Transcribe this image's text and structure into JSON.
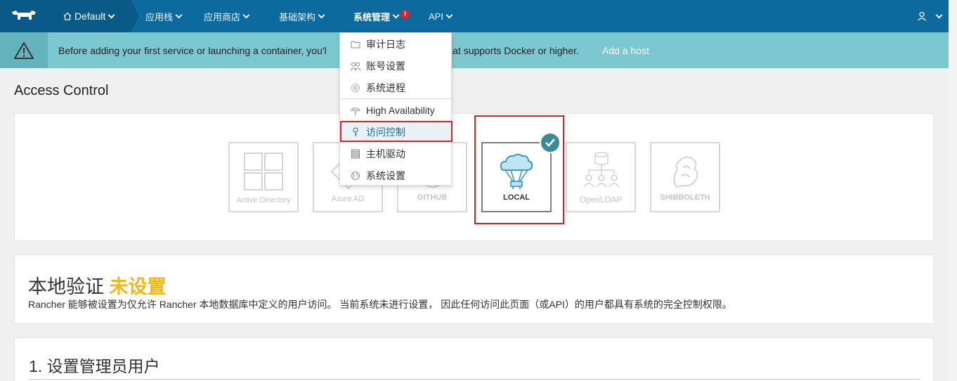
{
  "nav": {
    "environment": "Default",
    "items": [
      {
        "label": "应用栈"
      },
      {
        "label": "应用商店"
      },
      {
        "label": "基础架构"
      },
      {
        "label": "系统管理",
        "alert": "!"
      },
      {
        "label": "API"
      }
    ]
  },
  "banner": {
    "message": "Before adding your first service or launching a container, you'll need to add a Linux host that supports Docker or higher.",
    "message_visible_start": "Before adding your first service or launching a container, you'l",
    "message_visible_end": "t that supports Docker or higher.",
    "link": "Add a host"
  },
  "page": {
    "title": "Access Control"
  },
  "providers": [
    {
      "label": "Active Directory",
      "icon": "windows-icon"
    },
    {
      "label": "Azure AD",
      "icon": "azure-icon"
    },
    {
      "label": "GITHUB",
      "icon": "github-icon"
    },
    {
      "label": "LOCAL",
      "icon": "cloud-icon",
      "selected": true
    },
    {
      "label": "OpenLDAP",
      "icon": "ldap-icon"
    },
    {
      "label": "SHIBBOLETH",
      "icon": "shibboleth-icon"
    }
  ],
  "local_auth": {
    "heading": "本地验证",
    "status": "未设置",
    "description": "Rancher 能够被设置为仅允许 Rancher 本地数据库中定义的用户访问。 当前系统未进行设置， 因此任何访问此页面（或API）的用户都具有系统的完全控制权限。"
  },
  "step": {
    "title": "1. 设置管理员用户"
  },
  "dropdown": {
    "items": [
      {
        "label": "审计日志",
        "icon": "folder-icon"
      },
      {
        "label": "账号设置",
        "icon": "users-icon"
      },
      {
        "label": "系统进程",
        "icon": "gear-icon"
      },
      {
        "label": "High Availability",
        "icon": "umbrella-icon"
      },
      {
        "label": "访问控制",
        "icon": "key-icon",
        "highlighted": true
      },
      {
        "label": "主机驱动",
        "icon": "server-icon"
      },
      {
        "label": "系统设置",
        "icon": "globe-icon"
      }
    ]
  },
  "colors": {
    "nav": "#0c6a9f",
    "banner": "#7cc8d0",
    "status": "#f0b81a",
    "highlight": "#d9232a"
  }
}
